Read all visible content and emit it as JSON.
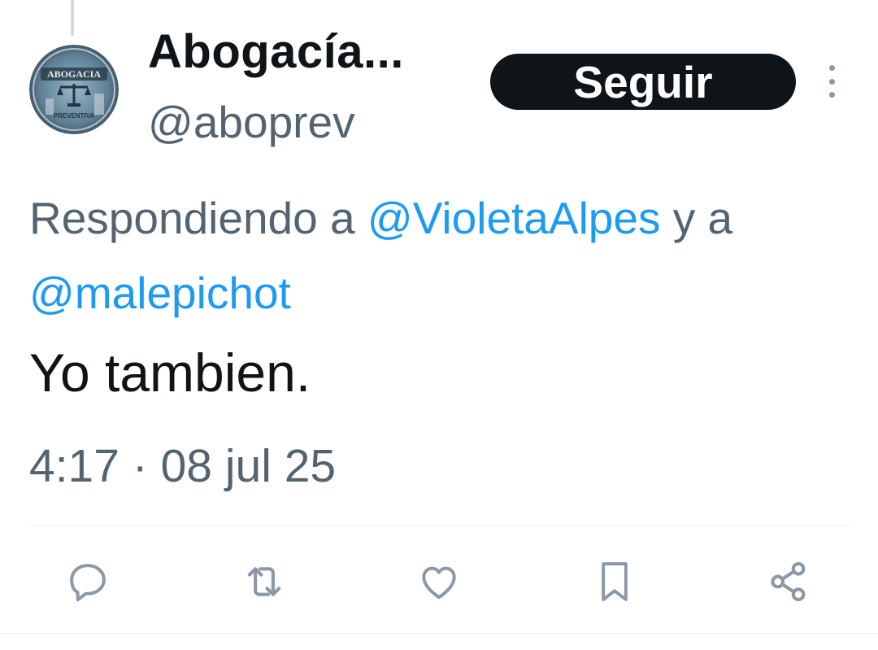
{
  "tweet": {
    "author": {
      "display_name": "Abogacía...",
      "handle": "@aboprev",
      "avatar_text_top": "ABOGACIA",
      "avatar_text_ring": "PREVENTIVA"
    },
    "follow_label": "Seguir",
    "more_icon": "more-vertical-icon",
    "reply_context": {
      "prefix": "Respondiendo a ",
      "mention_1": "@VioletaAlpes",
      "joiner": " y a ",
      "mention_2": "@malepichot"
    },
    "text": "Yo tambien.",
    "timestamp": "4:17 · 08 jul 25"
  },
  "actions": [
    {
      "name": "reply",
      "icon": "reply-icon"
    },
    {
      "name": "retweet",
      "icon": "retweet-icon"
    },
    {
      "name": "like",
      "icon": "heart-icon"
    },
    {
      "name": "bookmark",
      "icon": "bookmark-icon"
    },
    {
      "name": "share",
      "icon": "share-icon"
    }
  ],
  "colors": {
    "text_primary": "#0f1419",
    "text_secondary": "#536471",
    "link": "#1d9bf0",
    "icon": "#8b98a5",
    "button_bg": "#0f1419",
    "button_text": "#ffffff",
    "divider": "#eff3f4"
  }
}
